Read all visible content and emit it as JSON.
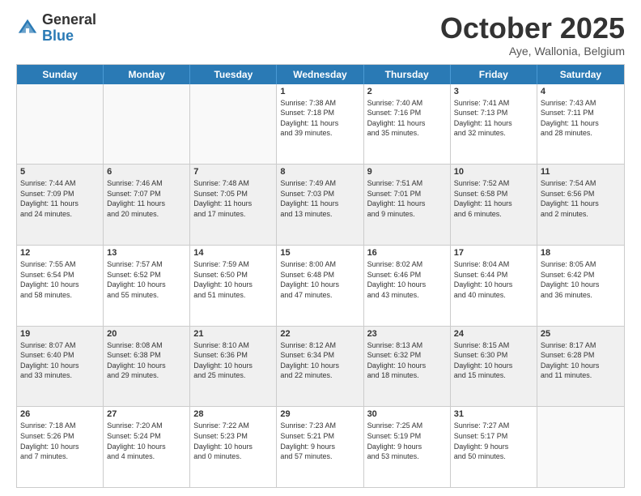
{
  "header": {
    "logo_general": "General",
    "logo_blue": "Blue",
    "month_title": "October 2025",
    "location": "Aye, Wallonia, Belgium"
  },
  "days_of_week": [
    "Sunday",
    "Monday",
    "Tuesday",
    "Wednesday",
    "Thursday",
    "Friday",
    "Saturday"
  ],
  "rows": [
    {
      "cells": [
        {
          "day": "",
          "info": "",
          "empty": true
        },
        {
          "day": "",
          "info": "",
          "empty": true
        },
        {
          "day": "",
          "info": "",
          "empty": true
        },
        {
          "day": "1",
          "info": "Sunrise: 7:38 AM\nSunset: 7:18 PM\nDaylight: 11 hours\nand 39 minutes."
        },
        {
          "day": "2",
          "info": "Sunrise: 7:40 AM\nSunset: 7:16 PM\nDaylight: 11 hours\nand 35 minutes."
        },
        {
          "day": "3",
          "info": "Sunrise: 7:41 AM\nSunset: 7:13 PM\nDaylight: 11 hours\nand 32 minutes."
        },
        {
          "day": "4",
          "info": "Sunrise: 7:43 AM\nSunset: 7:11 PM\nDaylight: 11 hours\nand 28 minutes."
        }
      ]
    },
    {
      "cells": [
        {
          "day": "5",
          "info": "Sunrise: 7:44 AM\nSunset: 7:09 PM\nDaylight: 11 hours\nand 24 minutes.",
          "shaded": true
        },
        {
          "day": "6",
          "info": "Sunrise: 7:46 AM\nSunset: 7:07 PM\nDaylight: 11 hours\nand 20 minutes.",
          "shaded": true
        },
        {
          "day": "7",
          "info": "Sunrise: 7:48 AM\nSunset: 7:05 PM\nDaylight: 11 hours\nand 17 minutes.",
          "shaded": true
        },
        {
          "day": "8",
          "info": "Sunrise: 7:49 AM\nSunset: 7:03 PM\nDaylight: 11 hours\nand 13 minutes.",
          "shaded": true
        },
        {
          "day": "9",
          "info": "Sunrise: 7:51 AM\nSunset: 7:01 PM\nDaylight: 11 hours\nand 9 minutes.",
          "shaded": true
        },
        {
          "day": "10",
          "info": "Sunrise: 7:52 AM\nSunset: 6:58 PM\nDaylight: 11 hours\nand 6 minutes.",
          "shaded": true
        },
        {
          "day": "11",
          "info": "Sunrise: 7:54 AM\nSunset: 6:56 PM\nDaylight: 11 hours\nand 2 minutes.",
          "shaded": true
        }
      ]
    },
    {
      "cells": [
        {
          "day": "12",
          "info": "Sunrise: 7:55 AM\nSunset: 6:54 PM\nDaylight: 10 hours\nand 58 minutes."
        },
        {
          "day": "13",
          "info": "Sunrise: 7:57 AM\nSunset: 6:52 PM\nDaylight: 10 hours\nand 55 minutes."
        },
        {
          "day": "14",
          "info": "Sunrise: 7:59 AM\nSunset: 6:50 PM\nDaylight: 10 hours\nand 51 minutes."
        },
        {
          "day": "15",
          "info": "Sunrise: 8:00 AM\nSunset: 6:48 PM\nDaylight: 10 hours\nand 47 minutes."
        },
        {
          "day": "16",
          "info": "Sunrise: 8:02 AM\nSunset: 6:46 PM\nDaylight: 10 hours\nand 43 minutes."
        },
        {
          "day": "17",
          "info": "Sunrise: 8:04 AM\nSunset: 6:44 PM\nDaylight: 10 hours\nand 40 minutes."
        },
        {
          "day": "18",
          "info": "Sunrise: 8:05 AM\nSunset: 6:42 PM\nDaylight: 10 hours\nand 36 minutes."
        }
      ]
    },
    {
      "cells": [
        {
          "day": "19",
          "info": "Sunrise: 8:07 AM\nSunset: 6:40 PM\nDaylight: 10 hours\nand 33 minutes.",
          "shaded": true
        },
        {
          "day": "20",
          "info": "Sunrise: 8:08 AM\nSunset: 6:38 PM\nDaylight: 10 hours\nand 29 minutes.",
          "shaded": true
        },
        {
          "day": "21",
          "info": "Sunrise: 8:10 AM\nSunset: 6:36 PM\nDaylight: 10 hours\nand 25 minutes.",
          "shaded": true
        },
        {
          "day": "22",
          "info": "Sunrise: 8:12 AM\nSunset: 6:34 PM\nDaylight: 10 hours\nand 22 minutes.",
          "shaded": true
        },
        {
          "day": "23",
          "info": "Sunrise: 8:13 AM\nSunset: 6:32 PM\nDaylight: 10 hours\nand 18 minutes.",
          "shaded": true
        },
        {
          "day": "24",
          "info": "Sunrise: 8:15 AM\nSunset: 6:30 PM\nDaylight: 10 hours\nand 15 minutes.",
          "shaded": true
        },
        {
          "day": "25",
          "info": "Sunrise: 8:17 AM\nSunset: 6:28 PM\nDaylight: 10 hours\nand 11 minutes.",
          "shaded": true
        }
      ]
    },
    {
      "cells": [
        {
          "day": "26",
          "info": "Sunrise: 7:18 AM\nSunset: 5:26 PM\nDaylight: 10 hours\nand 7 minutes."
        },
        {
          "day": "27",
          "info": "Sunrise: 7:20 AM\nSunset: 5:24 PM\nDaylight: 10 hours\nand 4 minutes."
        },
        {
          "day": "28",
          "info": "Sunrise: 7:22 AM\nSunset: 5:23 PM\nDaylight: 10 hours\nand 0 minutes."
        },
        {
          "day": "29",
          "info": "Sunrise: 7:23 AM\nSunset: 5:21 PM\nDaylight: 9 hours\nand 57 minutes."
        },
        {
          "day": "30",
          "info": "Sunrise: 7:25 AM\nSunset: 5:19 PM\nDaylight: 9 hours\nand 53 minutes."
        },
        {
          "day": "31",
          "info": "Sunrise: 7:27 AM\nSunset: 5:17 PM\nDaylight: 9 hours\nand 50 minutes."
        },
        {
          "day": "",
          "info": "",
          "empty": true
        }
      ]
    }
  ]
}
